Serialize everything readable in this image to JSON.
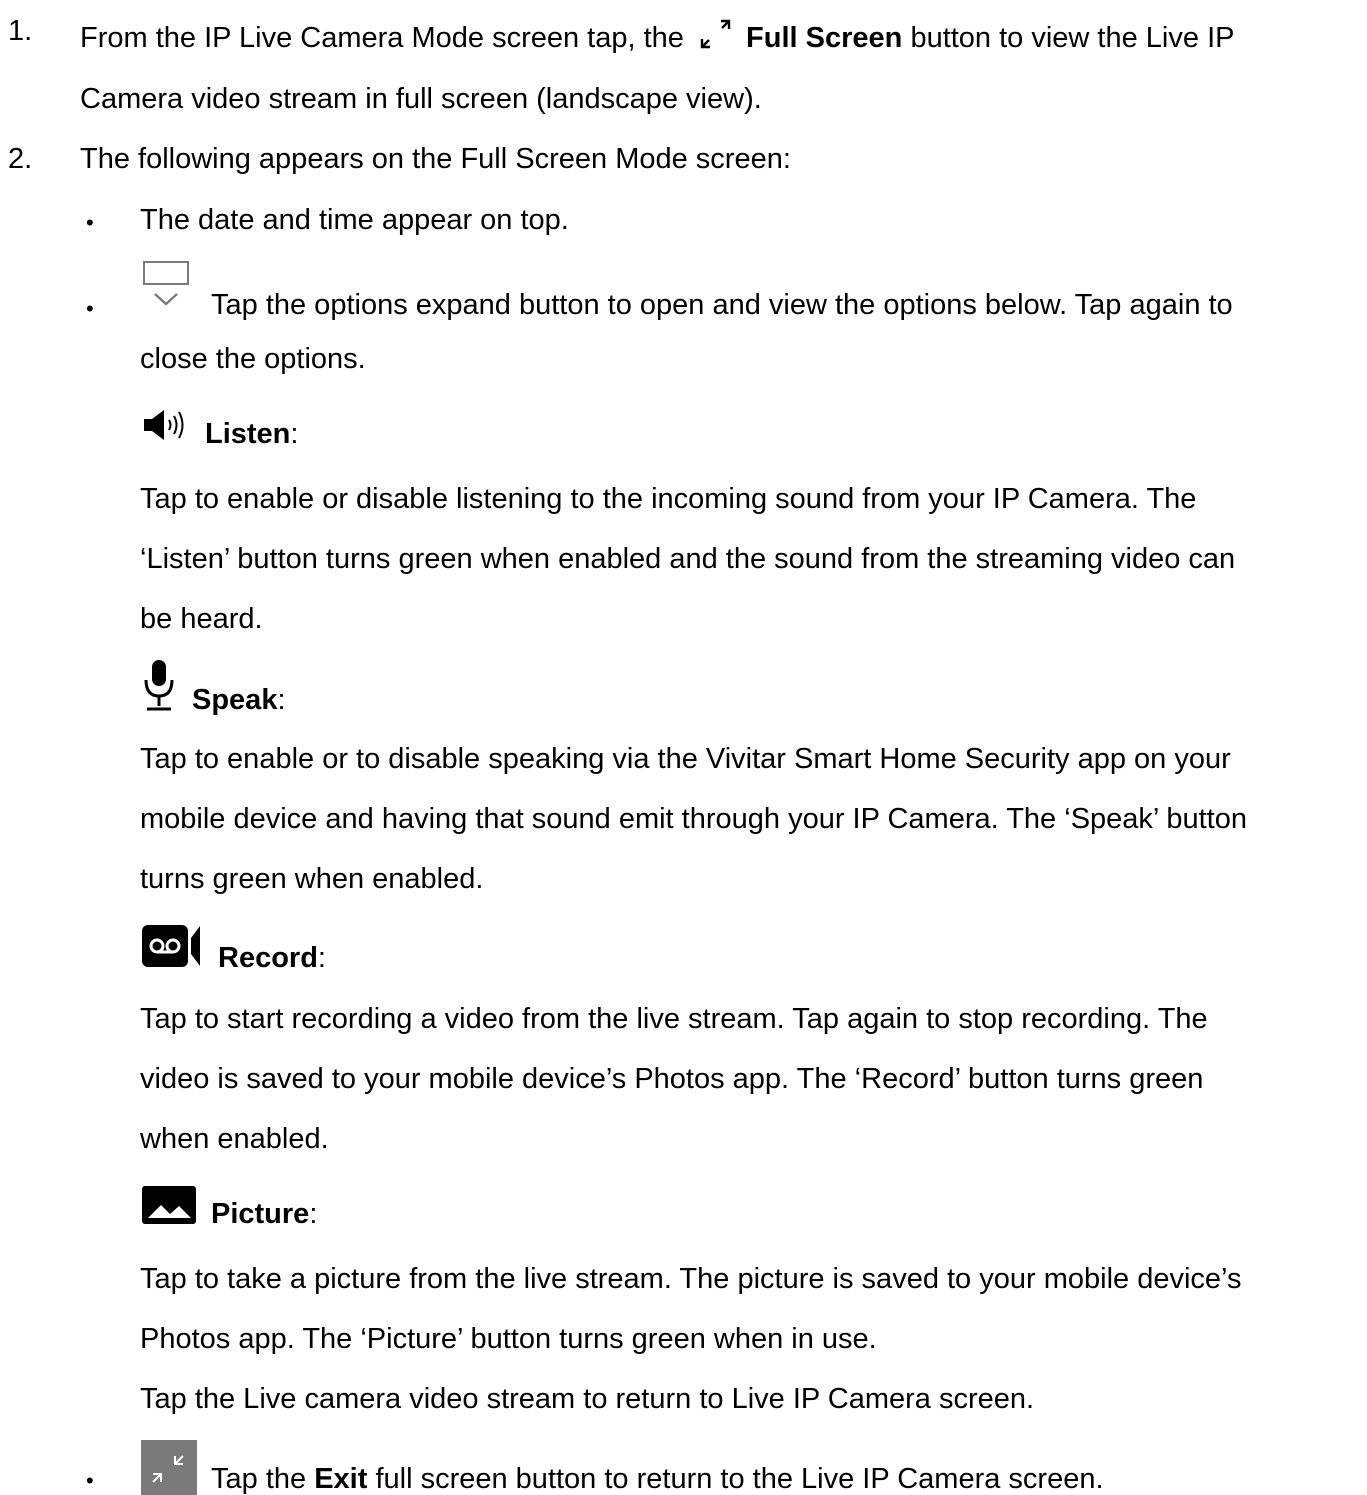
{
  "steps": [
    {
      "number": "1.",
      "line1_before": "From the IP Live Camera Mode screen tap, the",
      "line1_bold": "Full Screen",
      "line1_after": "button to view the Live IP",
      "line2": "Camera video stream in full screen (landscape view)."
    },
    {
      "number": "2.",
      "text": "The following appears on the Full Screen Mode screen:"
    }
  ],
  "bullets": {
    "symbol": "•",
    "date_time": "The date and time appear on top.",
    "expand_line1": "Tap the options expand button to open and view the options below. Tap again to",
    "expand_line2": "close the options.",
    "exit_before": "Tap the",
    "exit_bold": "Exit",
    "exit_after": "full screen button to return to the Live IP Camera screen."
  },
  "options": {
    "colon": ":",
    "listen": {
      "title": "Listen",
      "icon": "speaker-icon",
      "lines": [
        "Tap to enable or disable listening to the incoming sound from your IP Camera. The",
        "‘Listen’ button turns green when enabled and the sound from the streaming video can",
        "be heard."
      ]
    },
    "speak": {
      "title": "Speak",
      "icon": "microphone-icon",
      "lines": [
        "Tap to enable or to disable speaking via the Vivitar Smart Home Security app on your",
        "mobile device and having that sound emit through your IP Camera. The ‘Speak’ button",
        "turns green when enabled."
      ]
    },
    "record": {
      "title": "Record",
      "icon": "video-record-icon",
      "lines": [
        "Tap to start recording a video from the live stream. Tap again to stop recording. The",
        "video is saved to your mobile device’s Photos app. The ‘Record’ button turns green",
        "when enabled."
      ]
    },
    "picture": {
      "title": "Picture",
      "icon": "picture-icon",
      "lines": [
        "Tap to take a picture from the live stream. The picture is saved to your mobile device’s",
        "Photos app. The ‘Picture’ button turns green when in use.",
        "Tap the Live camera video stream to return to Live IP Camera screen."
      ]
    }
  },
  "icons": {
    "full_screen": "expand-arrows-icon",
    "options_expand": "screen-chevron-down-icon",
    "exit_full_screen": "collapse-arrows-icon",
    "exit_icon_bg": "#7a7a7a"
  }
}
